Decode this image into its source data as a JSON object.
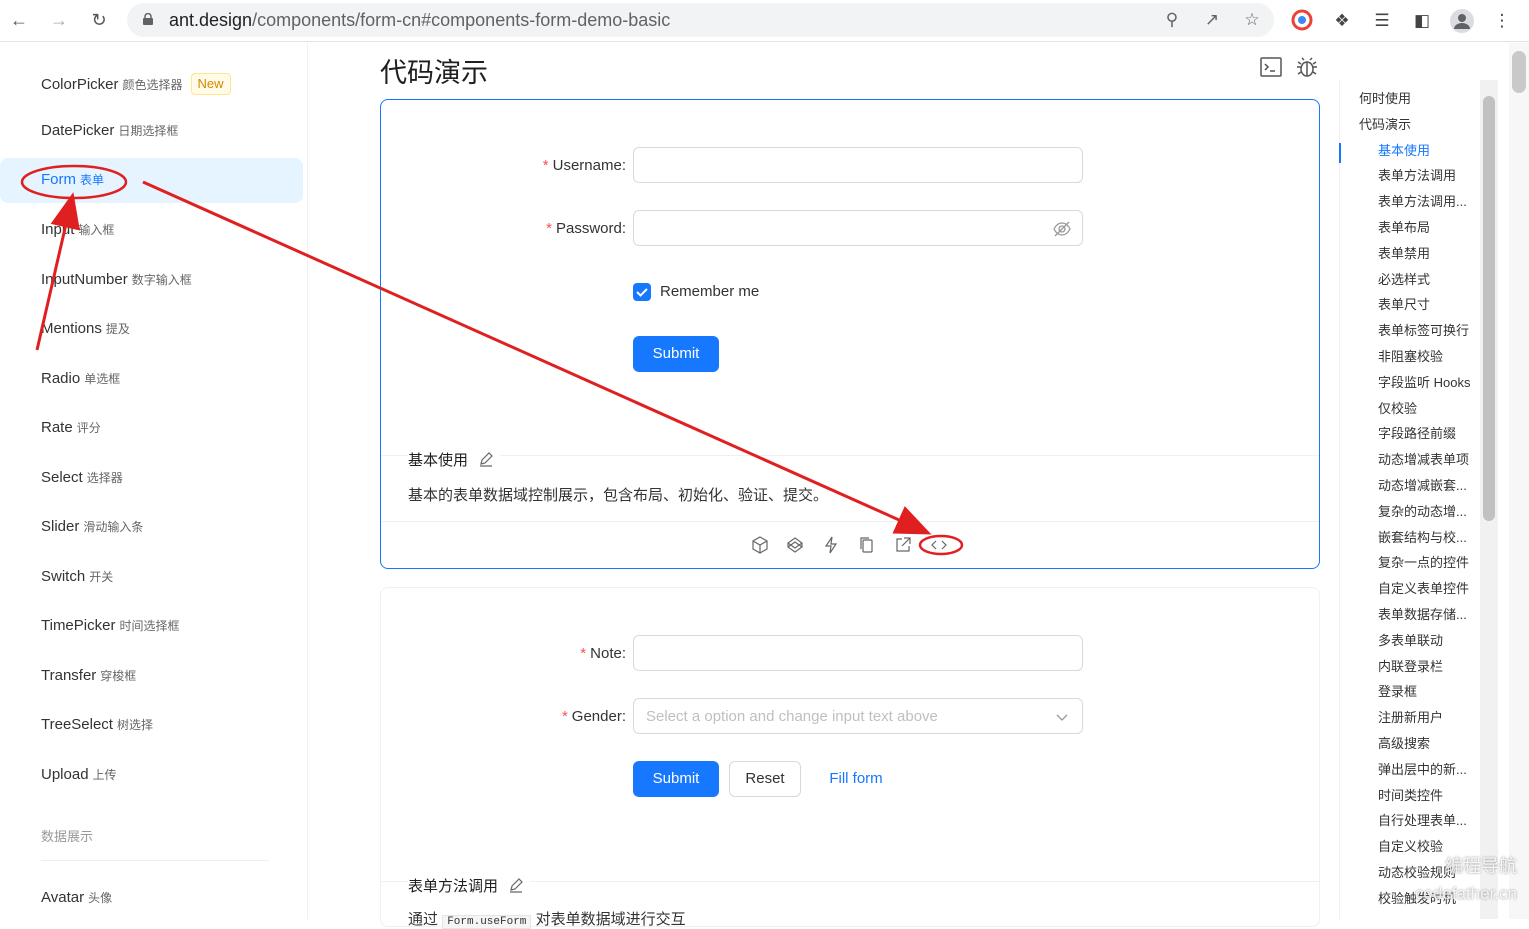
{
  "browser": {
    "url_main": "ant.design",
    "url_path": "/components/form-cn#components-form-demo-basic",
    "back_icon": "arrow-left-icon",
    "forward_icon": "arrow-right-icon",
    "reload_icon": "reload-icon"
  },
  "sidebar": {
    "items": [
      {
        "en": "ColorPicker",
        "zh": "颜色选择器",
        "badge": "New"
      },
      {
        "en": "DatePicker",
        "zh": "日期选择框"
      },
      {
        "en": "Form",
        "zh": "表单"
      },
      {
        "en": "Input",
        "zh": "输入框"
      },
      {
        "en": "InputNumber",
        "zh": "数字输入框"
      },
      {
        "en": "Mentions",
        "zh": "提及"
      },
      {
        "en": "Radio",
        "zh": "单选框"
      },
      {
        "en": "Rate",
        "zh": "评分"
      },
      {
        "en": "Select",
        "zh": "选择器"
      },
      {
        "en": "Slider",
        "zh": "滑动输入条"
      },
      {
        "en": "Switch",
        "zh": "开关"
      },
      {
        "en": "TimePicker",
        "zh": "时间选择框"
      },
      {
        "en": "Transfer",
        "zh": "穿梭框"
      },
      {
        "en": "TreeSelect",
        "zh": "树选择"
      },
      {
        "en": "Upload",
        "zh": "上传"
      },
      {
        "en": "Avatar",
        "zh": "头像"
      }
    ],
    "group_label": "数据展示"
  },
  "main": {
    "title": "代码演示",
    "demo1": {
      "username_label": "Username",
      "password_label": "Password",
      "remember_label": "Remember me",
      "remember_checked": true,
      "submit_label": "Submit",
      "meta_title": "基本使用",
      "meta_desc": "基本的表单数据域控制展示，包含布局、初始化、验证、提交。"
    },
    "demo2": {
      "note_label": "Note",
      "gender_label": "Gender",
      "gender_placeholder": "Select a option and change input text above",
      "submit_label": "Submit",
      "reset_label": "Reset",
      "fill_label": "Fill form",
      "meta_title": "表单方法调用",
      "meta_desc_start": "通过",
      "meta_desc_code": "Form.useForm",
      "meta_desc_end": "对表单数据域进行交互"
    }
  },
  "toc": {
    "items": [
      {
        "label": "何时使用",
        "level": 1
      },
      {
        "label": "代码演示",
        "level": 1
      },
      {
        "label": "基本使用",
        "level": 2,
        "active": true
      },
      {
        "label": "表单方法调用",
        "level": 2
      },
      {
        "label": "表单方法调用...",
        "level": 2
      },
      {
        "label": "表单布局",
        "level": 2
      },
      {
        "label": "表单禁用",
        "level": 2
      },
      {
        "label": "必选样式",
        "level": 2
      },
      {
        "label": "表单尺寸",
        "level": 2
      },
      {
        "label": "表单标签可换行",
        "level": 2
      },
      {
        "label": "非阻塞校验",
        "level": 2
      },
      {
        "label": "字段监听 Hooks",
        "level": 2
      },
      {
        "label": "仅校验",
        "level": 2
      },
      {
        "label": "字段路径前缀",
        "level": 2
      },
      {
        "label": "动态增减表单项",
        "level": 2
      },
      {
        "label": "动态增减嵌套...",
        "level": 2
      },
      {
        "label": "复杂的动态增...",
        "level": 2
      },
      {
        "label": "嵌套结构与校...",
        "level": 2
      },
      {
        "label": "复杂一点的控件",
        "level": 2
      },
      {
        "label": "自定义表单控件",
        "level": 2
      },
      {
        "label": "表单数据存储...",
        "level": 2
      },
      {
        "label": "多表单联动",
        "level": 2
      },
      {
        "label": "内联登录栏",
        "level": 2
      },
      {
        "label": "登录框",
        "level": 2
      },
      {
        "label": "注册新用户",
        "level": 2
      },
      {
        "label": "高级搜索",
        "level": 2
      },
      {
        "label": "弹出层中的新...",
        "level": 2
      },
      {
        "label": "时间类控件",
        "level": 2
      },
      {
        "label": "自行处理表单...",
        "level": 2
      },
      {
        "label": "自定义校验",
        "level": 2
      },
      {
        "label": "动态校验规则",
        "level": 2
      },
      {
        "label": "校验触发时机",
        "level": 2
      }
    ]
  },
  "watermark": {
    "line1": "编程导航",
    "line2": "codefather.cn"
  },
  "annotation_color": "#e02020",
  "accent_color": "#1677ff"
}
